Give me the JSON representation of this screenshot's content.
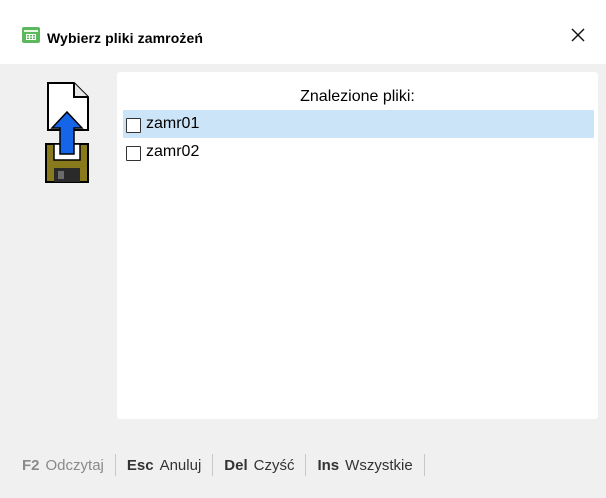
{
  "window": {
    "title": "Wybierz pliki zamrożeń",
    "icon": "cash-register-icon",
    "close_icon": "close-icon"
  },
  "panel": {
    "header": "Znalezione pliki:",
    "files": [
      {
        "name": "zamr01",
        "checked": false,
        "highlighted": true
      },
      {
        "name": "zamr02",
        "checked": false,
        "highlighted": false
      }
    ]
  },
  "hotkeys": [
    {
      "key": "F2",
      "label": "Odczytaj",
      "enabled": false
    },
    {
      "key": "Esc",
      "label": "Anuluj",
      "enabled": true
    },
    {
      "key": "Del",
      "label": "Czyść",
      "enabled": true
    },
    {
      "key": "Ins",
      "label": "Wszystkie",
      "enabled": true
    }
  ],
  "colors": {
    "highlight": "#cce4f7",
    "background": "#f0f0f0",
    "arrow": "#1565e8"
  }
}
